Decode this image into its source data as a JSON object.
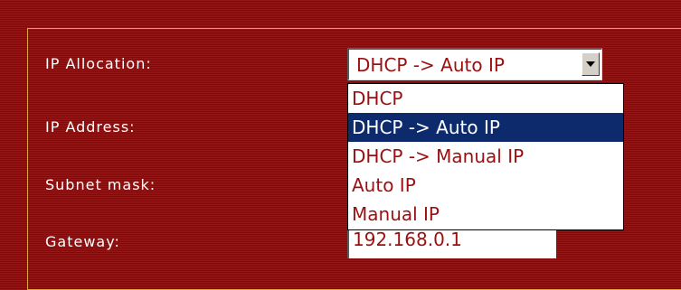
{
  "form": {
    "labels": {
      "ip_allocation": "IP Allocation:",
      "ip_address": "IP Address:",
      "subnet_mask": "Subnet mask:",
      "gateway": "Gateway:"
    },
    "ip_allocation_select": {
      "selected": "DHCP -> Auto IP",
      "options": [
        "DHCP",
        "DHCP -> Auto IP",
        "DHCP -> Manual IP",
        "Auto IP",
        "Manual IP"
      ],
      "highlighted_option": "DHCP -> Auto IP",
      "expanded": true
    },
    "gateway_value": "192.168.0.1"
  },
  "colors": {
    "background": "#8a1212",
    "panel_border": "#e2a23c",
    "label_text": "#ffffff",
    "option_text": "#9a1010",
    "highlight_bg": "#0d2a6d",
    "highlight_text": "#ffffff"
  },
  "icons": {
    "dropdown_arrow": "chevron-down-icon"
  }
}
